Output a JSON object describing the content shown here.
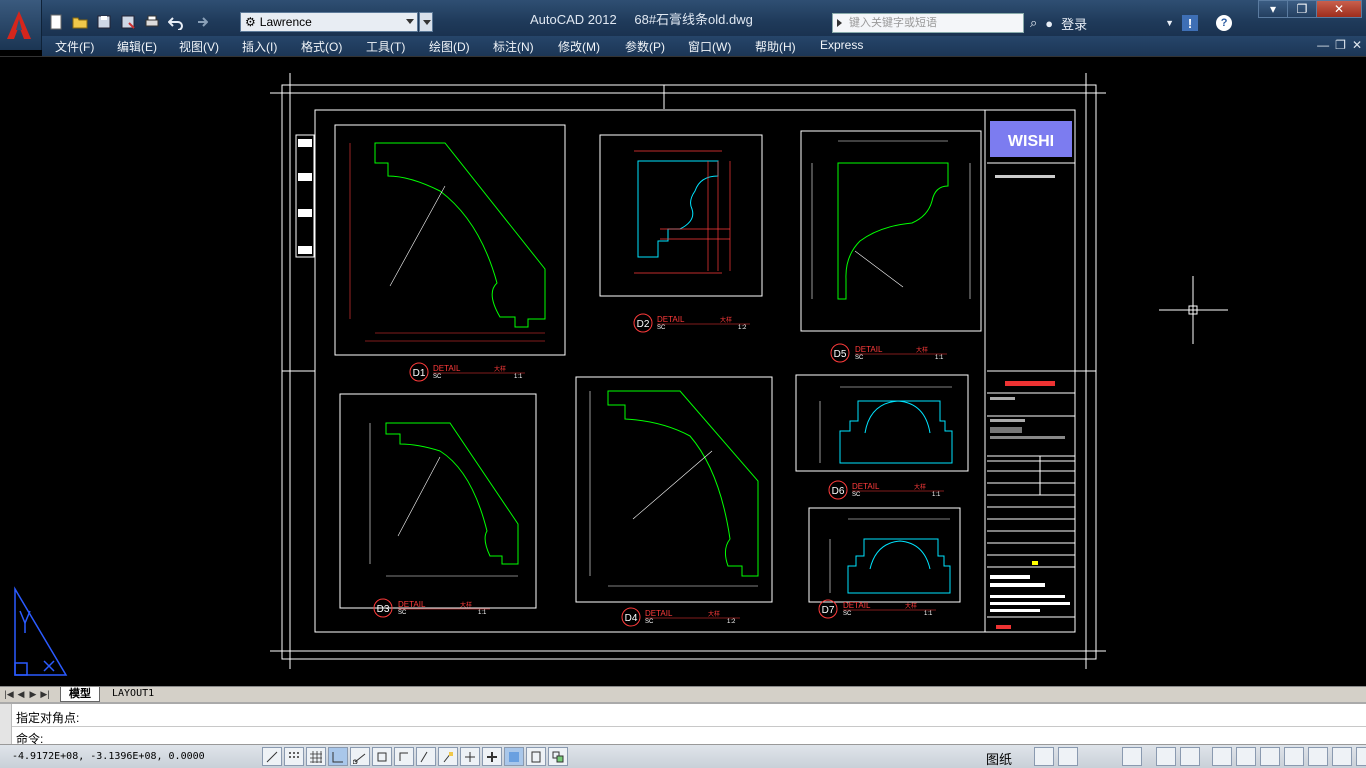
{
  "app": {
    "name": "AutoCAD 2012",
    "file": "68#石膏线条old.dwg"
  },
  "quick_access": {
    "workspace": "Lawrence",
    "search_placeholder": "键入关键字或短语",
    "login": "登录"
  },
  "menu": [
    "文件(F)",
    "编辑(E)",
    "视图(V)",
    "插入(I)",
    "格式(O)",
    "工具(T)",
    "绘图(D)",
    "标注(N)",
    "修改(M)",
    "参数(P)",
    "窗口(W)",
    "帮助(H)",
    "Express"
  ],
  "tabs": {
    "model": "模型",
    "layout": "LAYOUT1"
  },
  "command": {
    "history": "指定对角点:",
    "prompt": "命令:"
  },
  "status": {
    "coords": "-4.9172E+08, -3.1396E+08, 0.0000",
    "paper": "图纸"
  },
  "drawing": {
    "logo": "WISHI",
    "details": [
      {
        "id": "D1",
        "word": "DETAIL",
        "scale": "1:1",
        "sub": "SC",
        "tag": "大样"
      },
      {
        "id": "D2",
        "word": "DETAIL",
        "scale": "1:2",
        "sub": "SC",
        "tag": "大样"
      },
      {
        "id": "D3",
        "word": "DETAIL",
        "scale": "1:1",
        "sub": "SC",
        "tag": "大样"
      },
      {
        "id": "D4",
        "word": "DETAIL",
        "scale": "1:2",
        "sub": "SC",
        "tag": "大样"
      },
      {
        "id": "D5",
        "word": "DETAIL",
        "scale": "1:1",
        "sub": "SC",
        "tag": "大样"
      },
      {
        "id": "D6",
        "word": "DETAIL",
        "scale": "1:1",
        "sub": "SC",
        "tag": "大样"
      },
      {
        "id": "D7",
        "word": "DETAIL",
        "scale": "1:1",
        "sub": "SC",
        "tag": "大样"
      }
    ]
  },
  "colors": {
    "accent": "#1f3a5a",
    "canvas": "#000000",
    "profile": "#00ff00",
    "dimension": "#ff3b3b",
    "cyan": "#00e5ff"
  }
}
